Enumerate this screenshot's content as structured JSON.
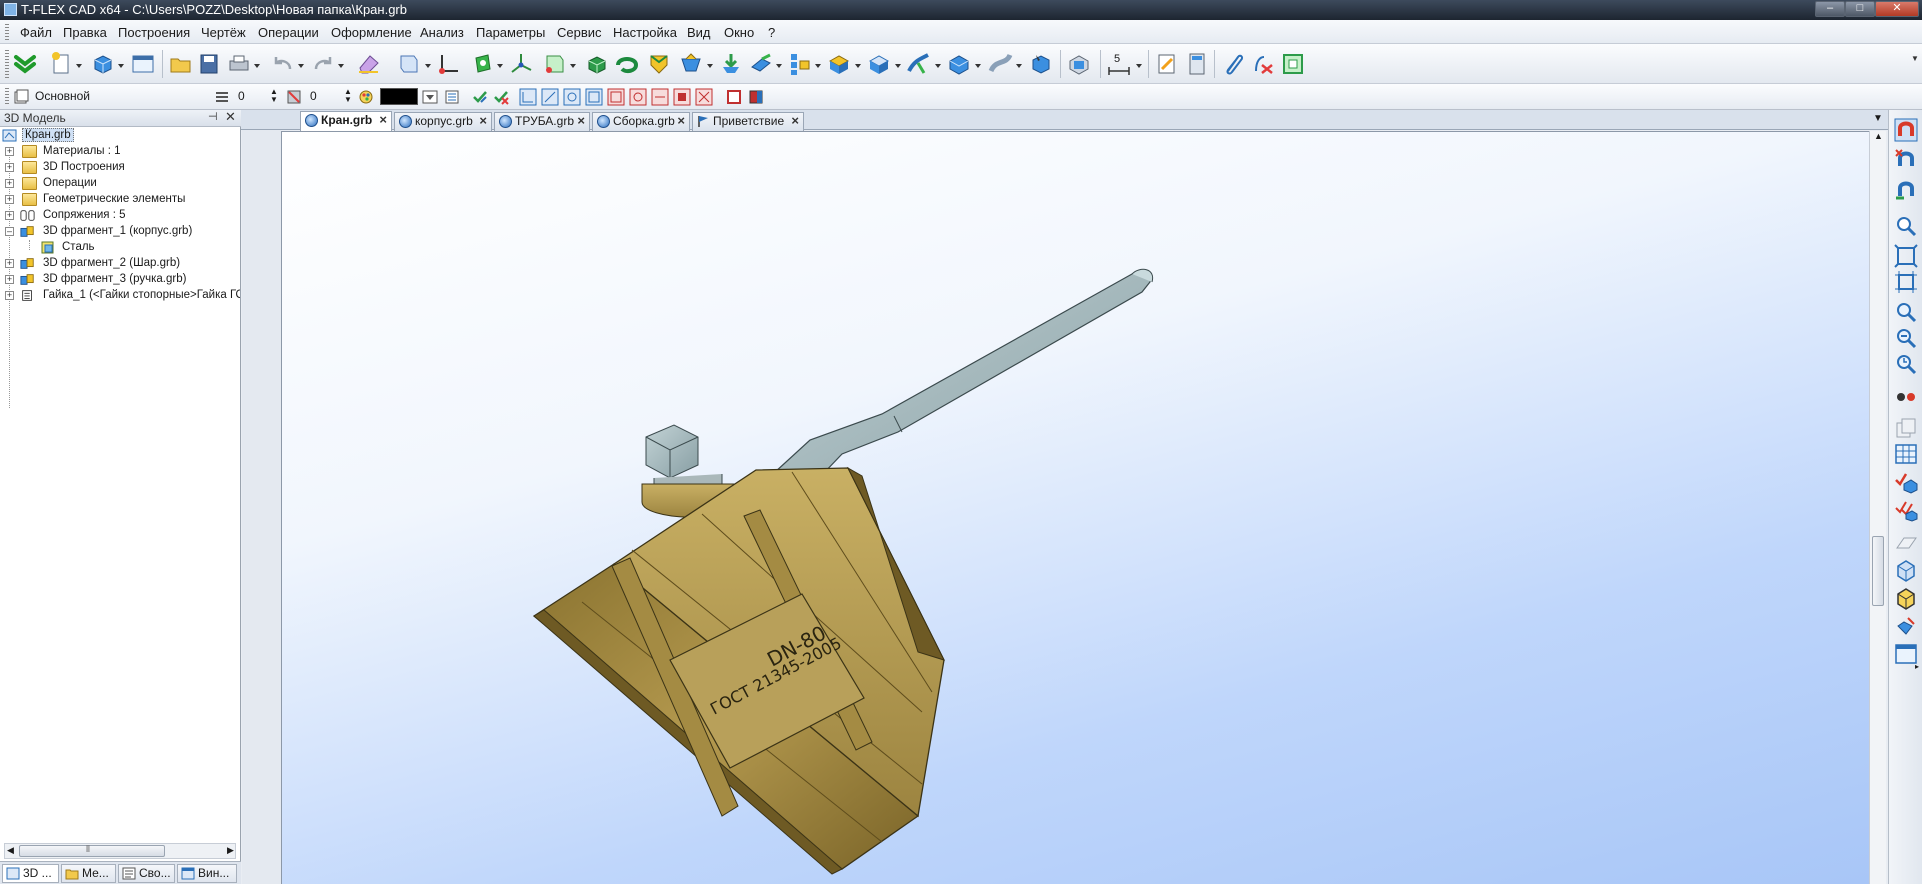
{
  "window": {
    "title": "T-FLEX CAD x64 - C:\\Users\\POZZ\\Desktop\\Новая папка\\Кран.grb",
    "buttons": [
      "–",
      "□",
      "✕"
    ]
  },
  "menu": [
    "Файл",
    "Правка",
    "Построения",
    "Чертёж",
    "Операции",
    "Оформление",
    "Анализ",
    "Параметры",
    "Сервис",
    "Настройка",
    "Вид",
    "Окно",
    "?"
  ],
  "toolbar2": {
    "layer_name": "Основной",
    "level_value": "0",
    "priority_value": "0",
    "color_value": "#000000"
  },
  "toolbar1": {
    "dimension_label": "5"
  },
  "left_panel": {
    "title": "3D Модель",
    "tree": [
      {
        "label": "Кран.grb",
        "level": 0,
        "icon": "model-icon",
        "expander": ""
      },
      {
        "label": "Материалы : 1",
        "level": 1,
        "icon": "folder-icon",
        "expander": "+"
      },
      {
        "label": "3D Построения",
        "level": 1,
        "icon": "folder-icon",
        "expander": "+"
      },
      {
        "label": "Операции",
        "level": 1,
        "icon": "folder-icon",
        "expander": "+"
      },
      {
        "label": "Геометрические элементы",
        "level": 1,
        "icon": "folder-icon",
        "expander": "+"
      },
      {
        "label": "Сопряжения : 5",
        "level": 1,
        "icon": "mates-icon",
        "expander": "+"
      },
      {
        "label": "3D фрагмент_1 (корпус.grb)",
        "level": 1,
        "icon": "fragment-icon",
        "expander": "–"
      },
      {
        "label": "Сталь",
        "level": 2,
        "icon": "material-icon",
        "expander": ""
      },
      {
        "label": "3D фрагмент_2 (Шар.grb)",
        "level": 1,
        "icon": "fragment-icon",
        "expander": "+"
      },
      {
        "label": "3D фрагмент_3 (ручка.grb)",
        "level": 1,
        "icon": "fragment-icon",
        "expander": "+"
      },
      {
        "label": "Гайка_1 (<Гайки стопорные>Гайка ГОС",
        "level": 1,
        "icon": "nut-icon",
        "expander": "+"
      }
    ],
    "bottom_tabs": [
      "3D ...",
      "Ме...",
      "Сво...",
      "Вин..."
    ]
  },
  "doc_tabs": [
    {
      "label": "Кран.grb",
      "active": true,
      "icon": "3d-doc-icon"
    },
    {
      "label": "корпус.grb",
      "active": false,
      "icon": "3d-doc-icon"
    },
    {
      "label": "ТРУБА.grb",
      "active": false,
      "icon": "3d-doc-icon"
    },
    {
      "label": "Сборка.grb",
      "active": false,
      "icon": "3d-doc-icon"
    },
    {
      "label": "Приветствие",
      "active": false,
      "icon": "flag-icon"
    }
  ],
  "model": {
    "engraving_line1": "DN-80",
    "engraving_line2": "ГОСТ 21345-2005",
    "body_color": "#b59a4f",
    "handle_color": "#9fb4b8"
  }
}
